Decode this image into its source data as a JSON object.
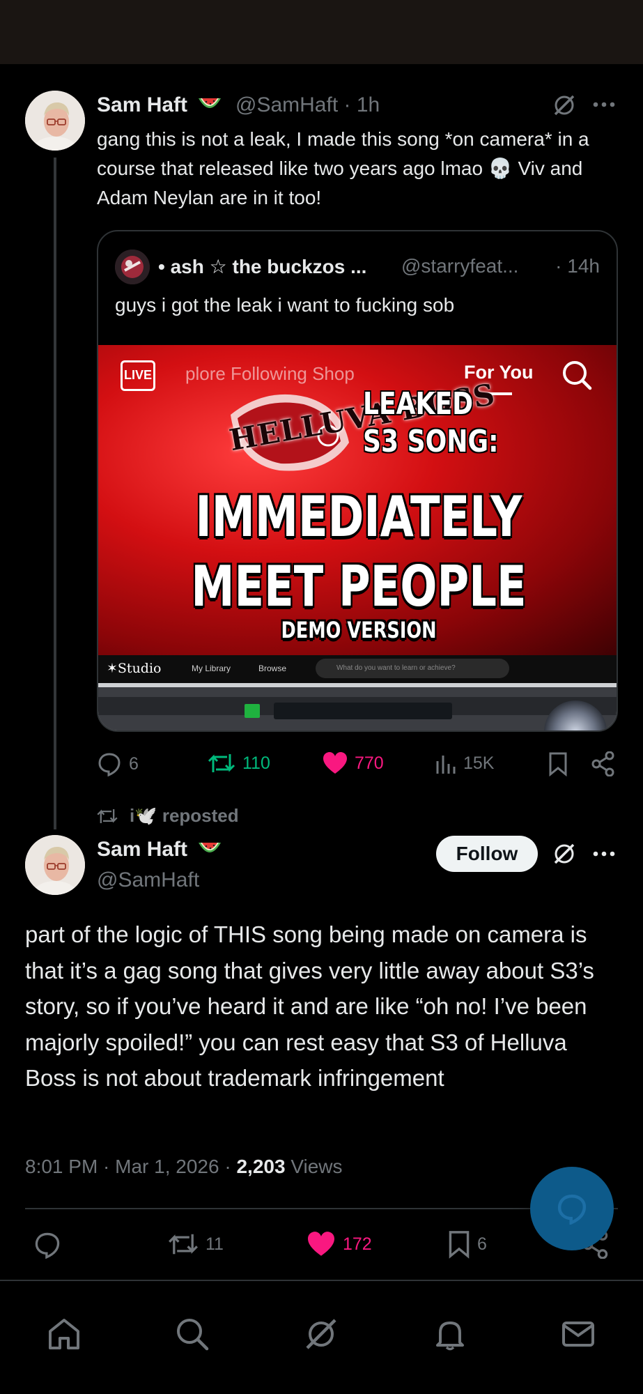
{
  "post1": {
    "name": "Sam Haft",
    "name_emoji": "watermelon-icon",
    "handle_time": "@SamHaft · 1h",
    "body": "gang this is not a leak, I made this song *on camera* in a course that released like two years ago lmao 💀 Viv and Adam Neylan are in it too!",
    "quote": {
      "name": "• ash ☆ the buckzos ...",
      "handle": "@starryfeat...",
      "time": "· 14h",
      "text": "guys i got the leak i want to fucking sob",
      "media": {
        "live_label": "LIVE",
        "nav_items": "plore    Following  Shop",
        "active_tab": "For You",
        "logo_text": "HELLUVA BOSS",
        "leaked_line1": "LEAKED",
        "leaked_line2": "S3 SONG:",
        "title_line1": "IMMEDIATELY",
        "title_line2": "MEET PEOPLE",
        "subtitle": "DEMO VERSION",
        "studio_logo": "✶Studio",
        "studio_links": [
          "My Library",
          "Browse"
        ],
        "studio_search_placeholder": "What do you want to learn or achieve?"
      }
    },
    "actions": {
      "replies": "6",
      "reposts": "110",
      "likes": "770",
      "views": "15K"
    }
  },
  "repost_label": "i🕊️ reposted",
  "post2": {
    "name": "Sam Haft",
    "handle": "@SamHaft",
    "follow_label": "Follow",
    "body": "part of the logic of THIS song being made on camera is that it’s a gag song that gives very little away about S3’s story, so if you’ve heard it and are like “oh no! I’ve been majorly spoiled!” you can rest easy that S3 of Helluva Boss is not about trademark infringement",
    "timestamp": "8:01 PM · Mar 1, 2026 · ",
    "views_count": "2,203",
    "views_label": " Views",
    "actions": {
      "reposts": "11",
      "likes": "172",
      "bookmarks": "6"
    }
  },
  "colors": {
    "repost_green": "#00ba7c",
    "like_pink": "#f91880",
    "muted": "#71767b",
    "fab_blue": "#0d5a8a"
  },
  "bottom_nav": [
    "home-icon",
    "search-icon",
    "grok-icon",
    "notifications-icon",
    "messages-icon"
  ]
}
